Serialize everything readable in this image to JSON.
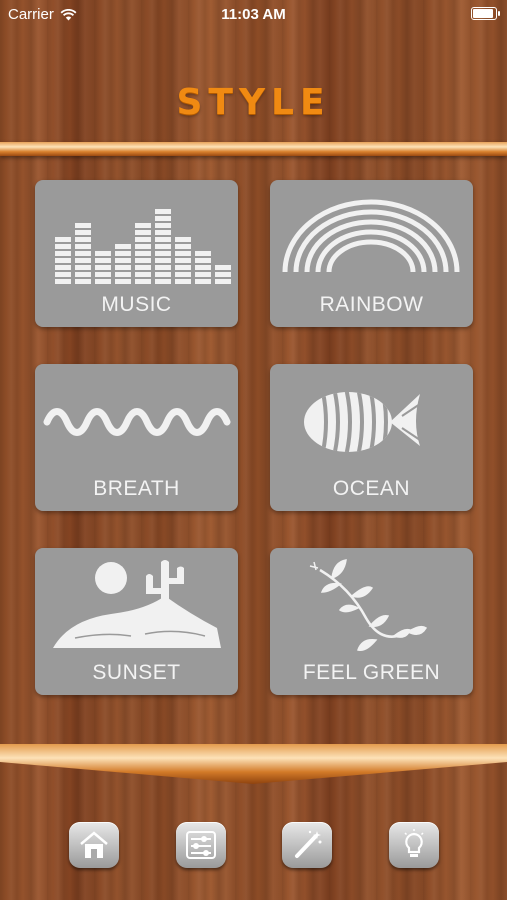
{
  "status_bar": {
    "carrier": "Carrier",
    "time": "11:03 AM",
    "battery_level": 1.0
  },
  "title": "STYLE",
  "tiles": [
    {
      "label": "MUSIC",
      "icon": "equalizer-icon"
    },
    {
      "label": "RAINBOW",
      "icon": "rainbow-icon"
    },
    {
      "label": "BREATH",
      "icon": "wave-icon"
    },
    {
      "label": "OCEAN",
      "icon": "fish-icon"
    },
    {
      "label": "SUNSET",
      "icon": "desert-sun-icon"
    },
    {
      "label": "FEEL GREEN",
      "icon": "leaf-branch-icon"
    }
  ],
  "nav": [
    {
      "icon": "home-icon"
    },
    {
      "icon": "sliders-icon"
    },
    {
      "icon": "magic-wand-icon"
    },
    {
      "icon": "lightbulb-icon"
    }
  ],
  "colors": {
    "title": "#f08a12",
    "tile": "#9a9a9a",
    "tile_text": "#f3f3f3",
    "accent_bar": "#d77f2c"
  }
}
